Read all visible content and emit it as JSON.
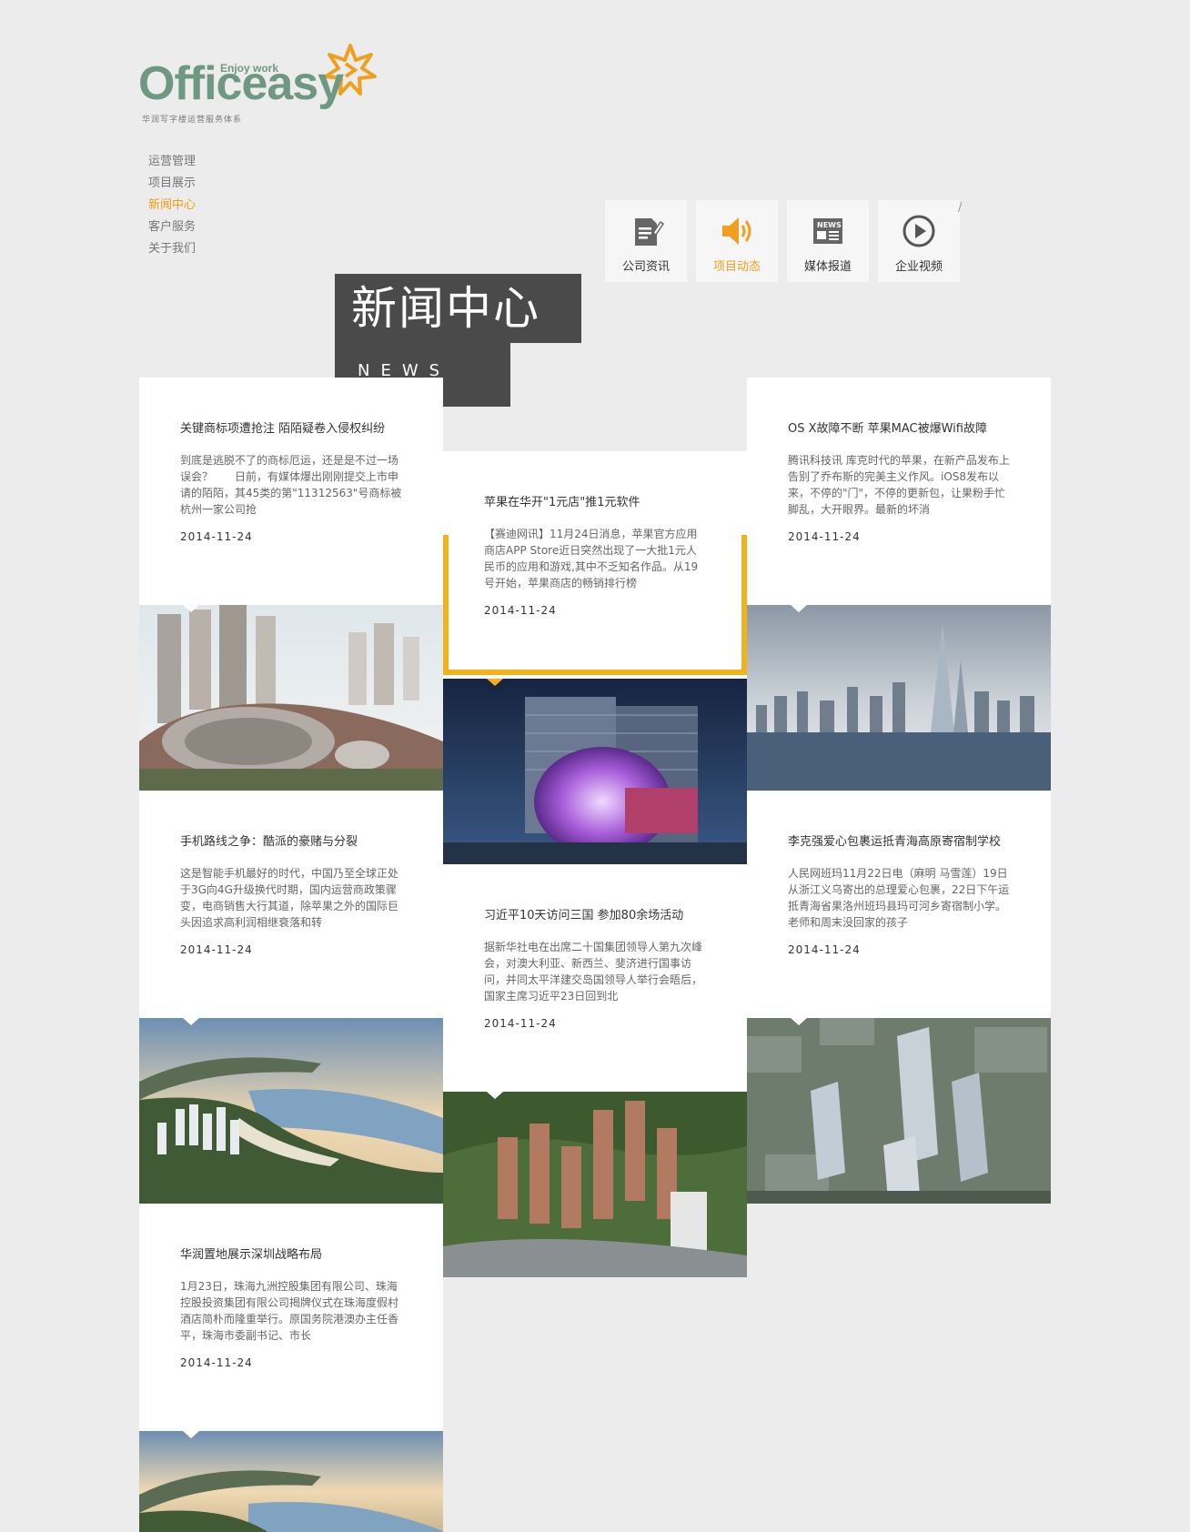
{
  "brand": {
    "name": "Officeasy",
    "tagline": "Enjoy work",
    "subtitle": "华润写字楼运营服务体系",
    "accent": "#f0a020",
    "logo_green": "#6f9882"
  },
  "nav": {
    "items": [
      {
        "label": "运营管理",
        "active": false
      },
      {
        "label": "项目展示",
        "active": false
      },
      {
        "label": "新闻中心",
        "active": true
      },
      {
        "label": "客户服务",
        "active": false
      },
      {
        "label": "关于我们",
        "active": false
      }
    ]
  },
  "tabs": [
    {
      "label": "公司资讯",
      "icon": "document-pen-icon",
      "active": false
    },
    {
      "label": "项目动态",
      "icon": "speaker-icon",
      "active": true
    },
    {
      "label": "媒体报道",
      "icon": "newspaper-icon",
      "active": false
    },
    {
      "label": "企业视频",
      "icon": "play-icon",
      "active": false
    }
  ],
  "tabs_divider": "/",
  "section": {
    "title": "新闻中心",
    "subtitle": "NEWS"
  },
  "news": [
    {
      "headline": "关键商标项遭抢注 陌陌疑卷入侵权纠纷",
      "summary": "到底是逃脱不了的商标厄运，还是是不过一场误会？　　日前，有媒体爆出刚刚提交上市申请的陌陌，其45类的第\"11312563\"号商标被杭州一家公司抢",
      "date": "2014-11-24",
      "image": "city-mall-photo"
    },
    {
      "headline": "苹果在华开\"1元店\"推1元软件",
      "summary": "【赛迪网讯】11月24日消息，苹果官方应用商店APP Store近日突然出现了一大批1元人民币的应用和游戏,其中不乏知名作品。从19号开始，苹果商店的畅销排行榜",
      "date": "2014-11-24",
      "image": "led-building-photo",
      "featured": true
    },
    {
      "headline": "OS X故障不断 苹果MAC被爆Wifi故障",
      "summary": "腾讯科技讯 库克时代的苹果，在新产品发布上告别了乔布斯的完美主义作风。iOS8发布以来，不停的\"门\"，不停的更新包，让果粉手忙脚乱，大开眼界。最新的坏消",
      "date": "2014-11-24",
      "image": "skyline-river-photo"
    },
    {
      "headline": "手机路线之争：酷派的豪赌与分裂",
      "summary": "这是智能手机最好的时代，中国乃至全球正处于3G向4G升级换代时期，国内运营商政策骤变，电商销售大行其道，除苹果之外的国际巨头因追求高利润相继衰落和转",
      "date": "2014-11-24",
      "image": "coast-bay-photo"
    },
    {
      "headline": "习近平10天访问三国 参加80余场活动",
      "summary": "据新华社电在出席二十国集团领导人第九次峰会，对澳大利亚、新西兰、斐济进行国事访问，并同太平洋建交岛国领导人举行会晤后，国家主席习近平23日回到北",
      "date": "2014-11-24",
      "image": "residential-towers-photo"
    },
    {
      "headline": "李克强爱心包裹运抵青海高原寄宿制学校",
      "summary": "人民网班玛11月22日电（麻明 马雪莲）19日从浙江义乌寄出的总理爱心包裹，22日下午运抵青海省果洛州班玛县玛可河乡寄宿制小学。老师和周末没回家的孩子",
      "date": "2014-11-24",
      "image": "aerial-towers-photo"
    },
    {
      "headline": "华润置地展示深圳战略布局",
      "summary": "1月23日，珠海九洲控股集团有限公司、珠海控股投资集团有限公司揭牌仪式在珠海度假村酒店简朴而隆重举行。原国务院港澳办主任香平，珠海市委副书记、市长",
      "date": "2014-11-24",
      "image": "coast-bay-photo-2"
    }
  ]
}
